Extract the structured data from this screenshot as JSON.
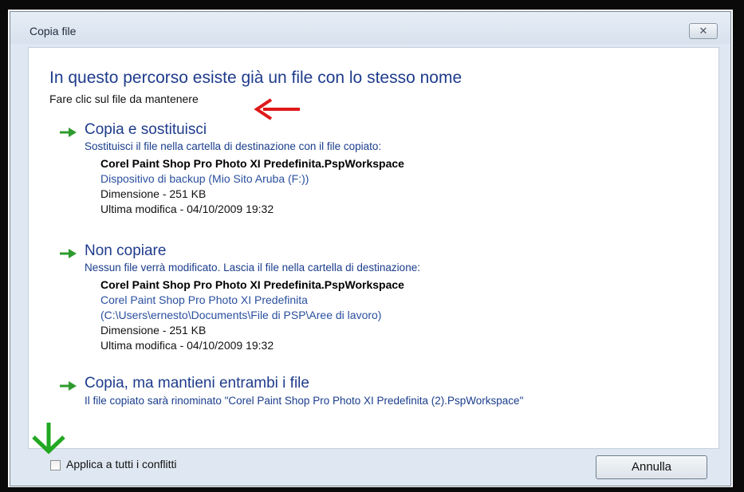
{
  "window": {
    "title": "Copia file",
    "close_label": "✕"
  },
  "main": {
    "heading": "In questo percorso esiste già un file con lo stesso nome",
    "subheading": "Fare clic sul file da mantenere"
  },
  "options": [
    {
      "title": "Copia e sostituisci",
      "description": "Sostituisci il file nella cartella di destinazione con il file copiato:",
      "file_name": "Corel Paint Shop Pro Photo XI Predefinita.PspWorkspace",
      "location": "Dispositivo di backup (Mio Sito  Aruba (F:))",
      "size": "Dimensione - 251 KB",
      "modified": "Ultima modifica - 04/10/2009 19:32"
    },
    {
      "title": "Non copiare",
      "description": "Nessun file verrà modificato. Lascia il file nella cartella di destinazione:",
      "file_name": "Corel Paint Shop Pro Photo XI Predefinita.PspWorkspace",
      "location_line1": "Corel Paint Shop Pro Photo XI Predefinita",
      "location_line2": "(C:\\Users\\ernesto\\Documents\\File di PSP\\Aree di lavoro)",
      "size": "Dimensione - 251 KB",
      "modified": "Ultima modifica - 04/10/2009 19:32"
    },
    {
      "title": "Copia, ma mantieni entrambi i file",
      "description": "Il file copiato sarà rinominato \"Corel Paint Shop Pro Photo XI Predefinita (2).PspWorkspace\""
    }
  ],
  "footer": {
    "apply_all_label": "Applica a tutti i conflitti",
    "apply_all_checked": false,
    "cancel_label": "Annulla"
  },
  "colors": {
    "link_blue": "#1f3c8c",
    "option_arrow_green": "#2e9b2e",
    "annotation_red": "#e01818",
    "annotation_green": "#22a822"
  },
  "icons": {
    "option_arrow": "green-right-arrow-icon",
    "annotation_red": "red-left-arrow-icon",
    "annotation_green": "green-down-arrow-icon"
  }
}
